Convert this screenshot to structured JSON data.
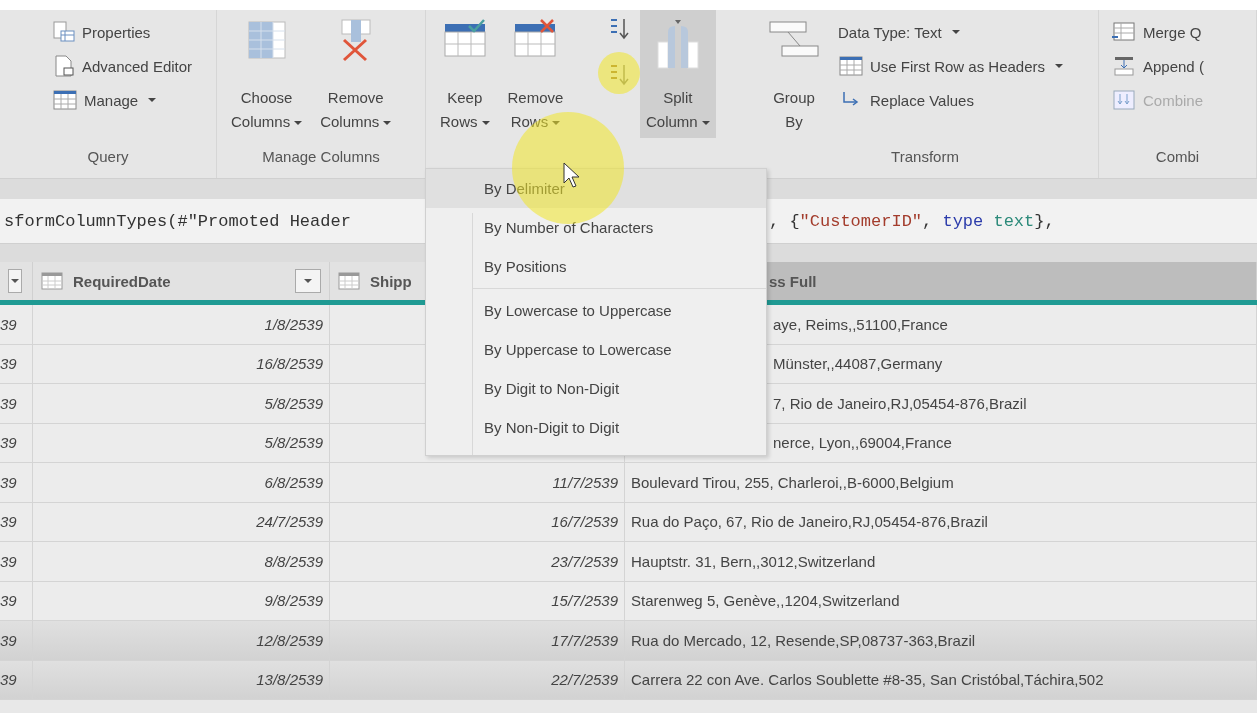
{
  "ribbon": {
    "groups": [
      {
        "label": "Query",
        "kind": "stack",
        "items": [
          {
            "label": "Properties"
          },
          {
            "label": "Advanced Editor"
          },
          {
            "label": "Manage",
            "dropdown": true
          }
        ]
      },
      {
        "label": "Manage Columns",
        "kind": "large",
        "items": [
          {
            "lines": [
              "Choose",
              "Columns"
            ],
            "dropdown": true,
            "selected": false
          },
          {
            "lines": [
              "Remove",
              "Columns"
            ],
            "dropdown": true,
            "selected": false
          }
        ]
      },
      {
        "kind": "large",
        "items": [
          {
            "lines": [
              "Keep",
              "Rows"
            ],
            "dropdown": true,
            "selected": false
          },
          {
            "lines": [
              "Remove",
              "Rows"
            ],
            "dropdown": true,
            "selected": false
          }
        ]
      },
      {
        "kind": "sort"
      },
      {
        "kind": "large",
        "items": [
          {
            "lines": [
              "Split",
              "Column"
            ],
            "dropdown": true,
            "selected": true
          }
        ]
      },
      {
        "label": "Transform",
        "kind": "large-stack",
        "items": [
          {
            "lines": [
              "Group",
              "By"
            ],
            "selected": false
          }
        ],
        "stack": [
          {
            "label": "Data Type: Text",
            "dropdown": true
          },
          {
            "label": "Use First Row as Headers",
            "dropdown": true
          },
          {
            "label": "Replace Values"
          }
        ]
      },
      {
        "label": "Combi",
        "kind": "stack",
        "items": [
          {
            "label": "Merge Q"
          },
          {
            "label": "Append ("
          },
          {
            "label": "Combine",
            "disabled": true
          }
        ]
      }
    ]
  },
  "formula": {
    "left": "sformColumnTypes(#\"Promoted Header",
    "right": [
      {
        "kind": "plain",
        "text": ", {"
      },
      {
        "kind": "string",
        "text": "\"CustomerID\""
      },
      {
        "kind": "plain",
        "text": ", "
      },
      {
        "kind": "keyword",
        "text": "type"
      },
      {
        "kind": "type",
        "text": " text"
      },
      {
        "kind": "plain",
        "text": "},"
      }
    ]
  },
  "table": {
    "columns": [
      {
        "label": "RequiredDate"
      },
      {
        "label": "Shipp"
      },
      {
        "label": "ss Full"
      }
    ],
    "rows": [
      {
        "c0": "39",
        "req": "1/8/2539",
        "addr": "aye, Reims,,51100,France",
        "highlighted": false
      },
      {
        "c0": "39",
        "req": "16/8/2539",
        "addr": "Münster,,44087,Germany",
        "highlighted": false
      },
      {
        "c0": "39",
        "req": "5/8/2539",
        "addr": "7, Rio de Janeiro,RJ,05454-876,Brazil",
        "highlighted": false
      },
      {
        "c0": "39",
        "req": "5/8/2539",
        "addr": "nerce, Lyon,,69004,France",
        "highlighted": false
      },
      {
        "c0": "39",
        "req": "6/8/2539",
        "ship": "11/7/2539",
        "addr": "Boulevard Tirou, 255, Charleroi,,B-6000,Belgium",
        "highlighted": false
      },
      {
        "c0": "39",
        "req": "24/7/2539",
        "ship": "16/7/2539",
        "addr": "Rua do Paço, 67, Rio de Janeiro,RJ,05454-876,Brazil",
        "highlighted": false
      },
      {
        "c0": "39",
        "req": "8/8/2539",
        "ship": "23/7/2539",
        "addr": "Hauptstr. 31, Bern,,3012,Switzerland",
        "highlighted": false
      },
      {
        "c0": "39",
        "req": "9/8/2539",
        "ship": "15/7/2539",
        "addr": "Starenweg 5, Genève,,1204,Switzerland",
        "highlighted": false
      },
      {
        "c0": "39",
        "req": "12/8/2539",
        "ship": "17/7/2539",
        "addr": "Rua do Mercado, 12, Resende,SP,08737-363,Brazil",
        "highlighted": true
      },
      {
        "c0": "39",
        "req": "13/8/2539",
        "ship": "22/7/2539",
        "addr": "Carrera 22 con Ave. Carlos Soublette #8-35, San Cristóbal,Táchira,502",
        "highlighted": true
      }
    ]
  },
  "menu": {
    "items": [
      {
        "label": "By Delimiter",
        "selected": true,
        "separator_before": false
      },
      {
        "label": "By Number of Characters",
        "selected": false,
        "separator_before": false
      },
      {
        "label": "By Positions",
        "selected": false,
        "separator_before": false
      },
      {
        "label": "By Lowercase to Uppercase",
        "selected": false,
        "separator_before": true
      },
      {
        "label": "By Uppercase to Lowercase",
        "selected": false,
        "separator_before": false
      },
      {
        "label": "By Digit to Non-Digit",
        "selected": false,
        "separator_before": false
      },
      {
        "label": "By Non-Digit to Digit",
        "selected": false,
        "separator_before": false
      }
    ]
  }
}
